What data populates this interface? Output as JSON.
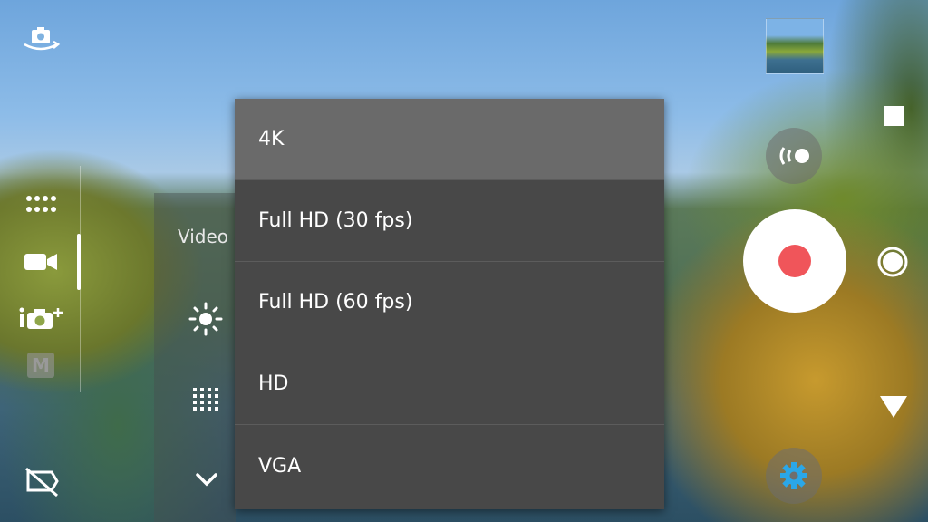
{
  "submenu": {
    "label": "Video"
  },
  "resolution_menu": {
    "options": [
      {
        "label": "4K",
        "selected": true
      },
      {
        "label": "Full HD (30 fps)",
        "selected": false
      },
      {
        "label": "Full HD (60 fps)",
        "selected": false
      },
      {
        "label": "HD",
        "selected": false
      },
      {
        "label": "VGA",
        "selected": false
      }
    ]
  },
  "left_icons": {
    "mode_m_label": "M"
  },
  "icons": [
    "switch-camera-icon",
    "grid-dots-icon",
    "video-mode-icon",
    "camera-plus-icon",
    "manual-mode-icon",
    "flash-off-icon",
    "brightness-icon",
    "resolution-grid-icon",
    "chevron-down-icon",
    "thumbnail",
    "stop-icon",
    "pan-zoom-icon",
    "record-icon",
    "snapshot-icon",
    "play-triangle-icon",
    "settings-gear-icon"
  ],
  "colors": {
    "record_red": "#f0555a",
    "settings_blue": "#2aa7e8",
    "menu_bg": "#484848",
    "menu_selected_bg": "#6a6a6a"
  }
}
